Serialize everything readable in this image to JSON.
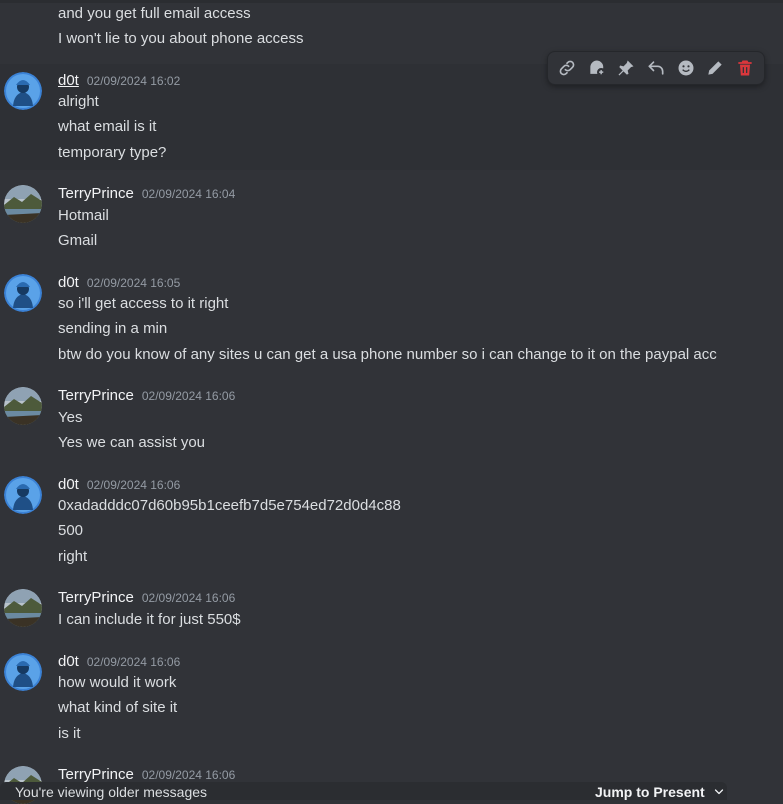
{
  "messages_top": [
    "and you get full email access",
    "I won't lie to you about phone access"
  ],
  "groups": [
    {
      "author": "d0t",
      "timestamp": "02/09/2024 16:02",
      "avatar": "blue-hooded-avatar",
      "lines": [
        "alright",
        "what email is it",
        "temporary type?"
      ]
    },
    {
      "author": "TerryPrince",
      "timestamp": "02/09/2024 16:04",
      "avatar": "landscape-avatar",
      "lines": [
        "Hotmail",
        "Gmail"
      ]
    },
    {
      "author": "d0t",
      "timestamp": "02/09/2024 16:05",
      "avatar": "blue-hooded-avatar",
      "lines": [
        "so i'll get access to it right",
        "sending in a min",
        "btw do you know of any sites u can get a usa phone number so i can change to it on the paypal acc"
      ]
    },
    {
      "author": "TerryPrince",
      "timestamp": "02/09/2024 16:06",
      "avatar": "landscape-avatar",
      "lines": [
        "Yes",
        "Yes we can assist you"
      ]
    },
    {
      "author": "d0t",
      "timestamp": "02/09/2024 16:06",
      "avatar": "blue-hooded-avatar",
      "lines": [
        "0xadadddc07d60b95b1ceefb7d5e754ed72d0d4c88",
        "500",
        "right"
      ]
    },
    {
      "author": "TerryPrince",
      "timestamp": "02/09/2024 16:06",
      "avatar": "landscape-avatar",
      "lines": [
        "I can include it for just 550$"
      ]
    },
    {
      "author": "d0t",
      "timestamp": "02/09/2024 16:06",
      "avatar": "blue-hooded-avatar",
      "lines": [
        "how would it work",
        "what kind of site it",
        "is it"
      ]
    },
    {
      "author": "TerryPrince",
      "timestamp": "02/09/2024 16:06",
      "avatar": "landscape-avatar",
      "lines": []
    }
  ],
  "toolbar": {
    "icons": [
      "link-icon",
      "thread-icon",
      "pin-icon",
      "reply-icon",
      "emoji-icon",
      "edit-icon",
      "delete-icon"
    ],
    "delete_color": "#da373c"
  },
  "footer": {
    "older_text": "You're viewing older messages",
    "jump_label": "Jump to Present"
  }
}
